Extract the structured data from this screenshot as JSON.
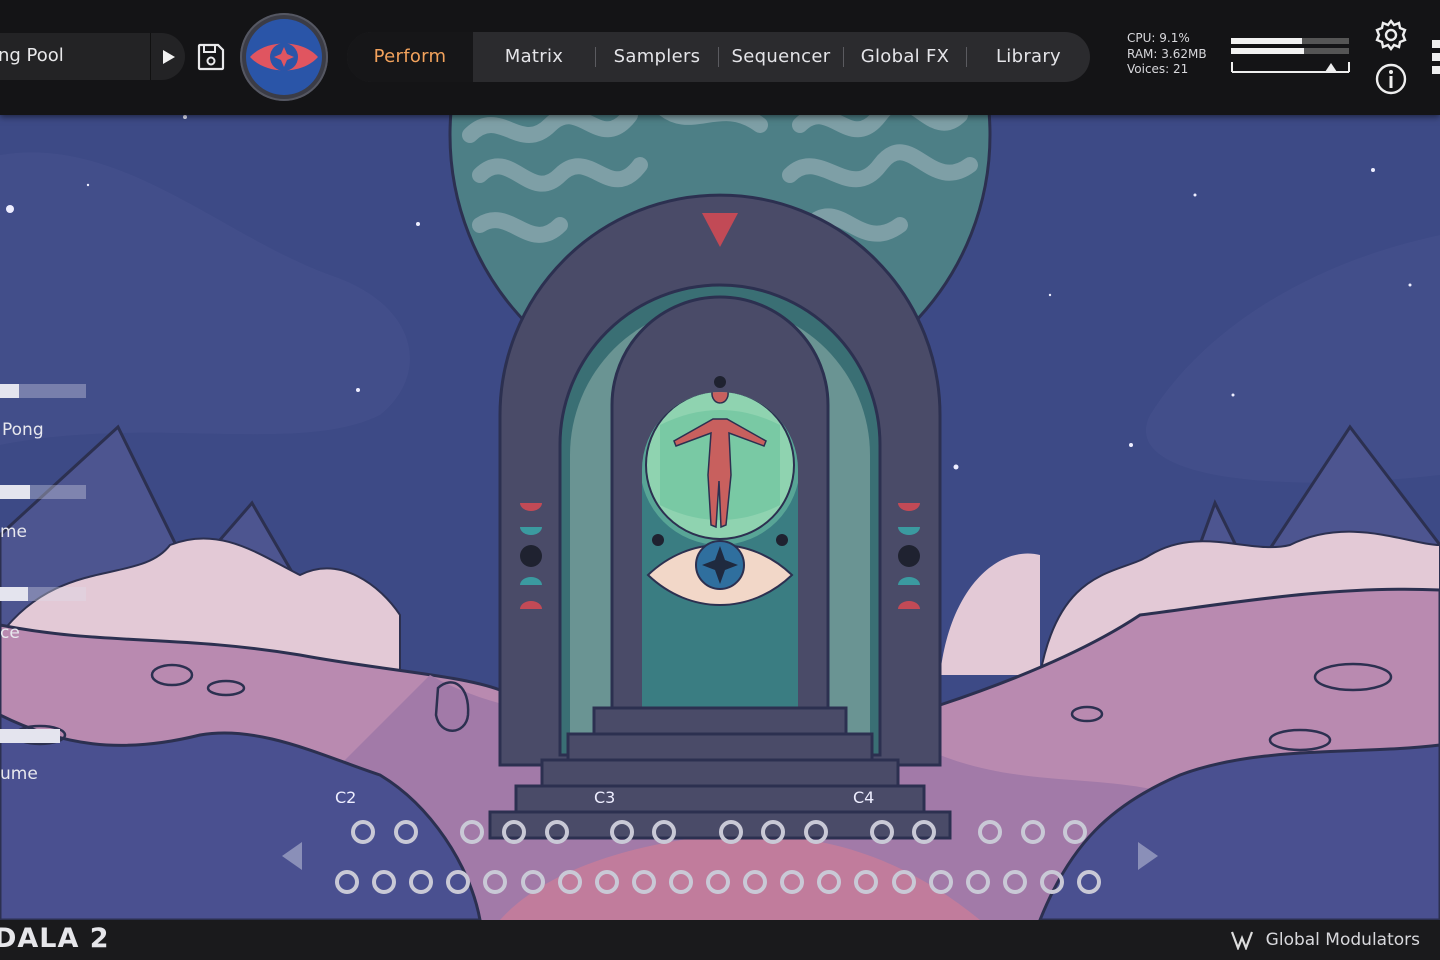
{
  "preset": {
    "name": "ng Pool"
  },
  "tabs": [
    {
      "label": "Perform",
      "active": true
    },
    {
      "label": "Matrix"
    },
    {
      "label": "Samplers"
    },
    {
      "label": "Sequencer"
    },
    {
      "label": "Global FX"
    },
    {
      "label": "Library"
    }
  ],
  "stats": {
    "cpu": "CPU: 9.1%",
    "ram": "RAM: 3.62MB",
    "voices": "Voices: 21"
  },
  "meters": {
    "left_level": 0.6,
    "right_level": 0.62
  },
  "side_controls": [
    {
      "label": "",
      "level": 0.22
    },
    {
      "label": "Pong",
      "level": 0
    },
    {
      "label": "",
      "level": 0.35
    },
    {
      "label": "me",
      "level": 0
    },
    {
      "label": "",
      "level": 0.33
    },
    {
      "label": "ce",
      "level": 0
    },
    {
      "label": "",
      "level": 1
    },
    {
      "label": "ume",
      "level": 0
    }
  ],
  "keyboard": {
    "octaves": [
      "C2",
      "C3",
      "C4"
    ]
  },
  "bottom": {
    "brand": "DALA 2",
    "modulators": "Global Modulators"
  },
  "colors": {
    "accent": "#f2a25c",
    "topbar": "#141416",
    "sky": "#3d4a86"
  },
  "icons": [
    "play-icon",
    "save-icon",
    "eye-logo-icon",
    "gear-icon",
    "info-icon",
    "modulator-logo-icon",
    "arrow-left-icon",
    "arrow-right-icon"
  ]
}
